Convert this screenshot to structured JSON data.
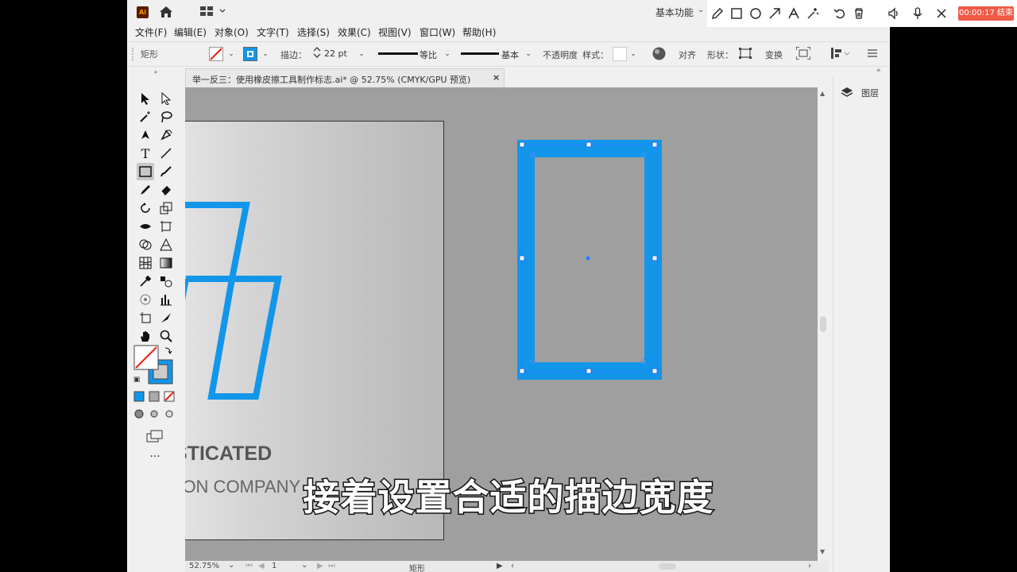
{
  "app": {
    "logo": "Ai",
    "workspace": "基本功能"
  },
  "menu": [
    "文件(F)",
    "编辑(E)",
    "对象(O)",
    "文字(T)",
    "选择(S)",
    "效果(C)",
    "视图(V)",
    "窗口(W)",
    "帮助(H)"
  ],
  "control": {
    "object_type": "矩形",
    "stroke_label": "描边：",
    "stroke_value": "22 pt",
    "profile_label": "等比",
    "brush_label": "基本",
    "opacity_label": "不透明度",
    "style_label": "样式：",
    "align_label": "对齐",
    "shape_label": "形状：",
    "transform_label": "变换"
  },
  "document": {
    "tab_title": "举一反三：使用橡皮擦工具制作标志.ai* @ 52.75% (CMYK/GPU 预览)",
    "close": "×"
  },
  "artboard": {
    "logo_line1": "HISTICATED",
    "logo_line2": "CTION COMPANY",
    "accent": "#1296ea"
  },
  "status": {
    "zoom": "52.75%",
    "page": "1",
    "tool": "矩形"
  },
  "panel": {
    "layers_label": "图层"
  },
  "recorder": {
    "timer": "00:00:17 结束"
  },
  "subtitle": "接着设置合适的描边宽度"
}
